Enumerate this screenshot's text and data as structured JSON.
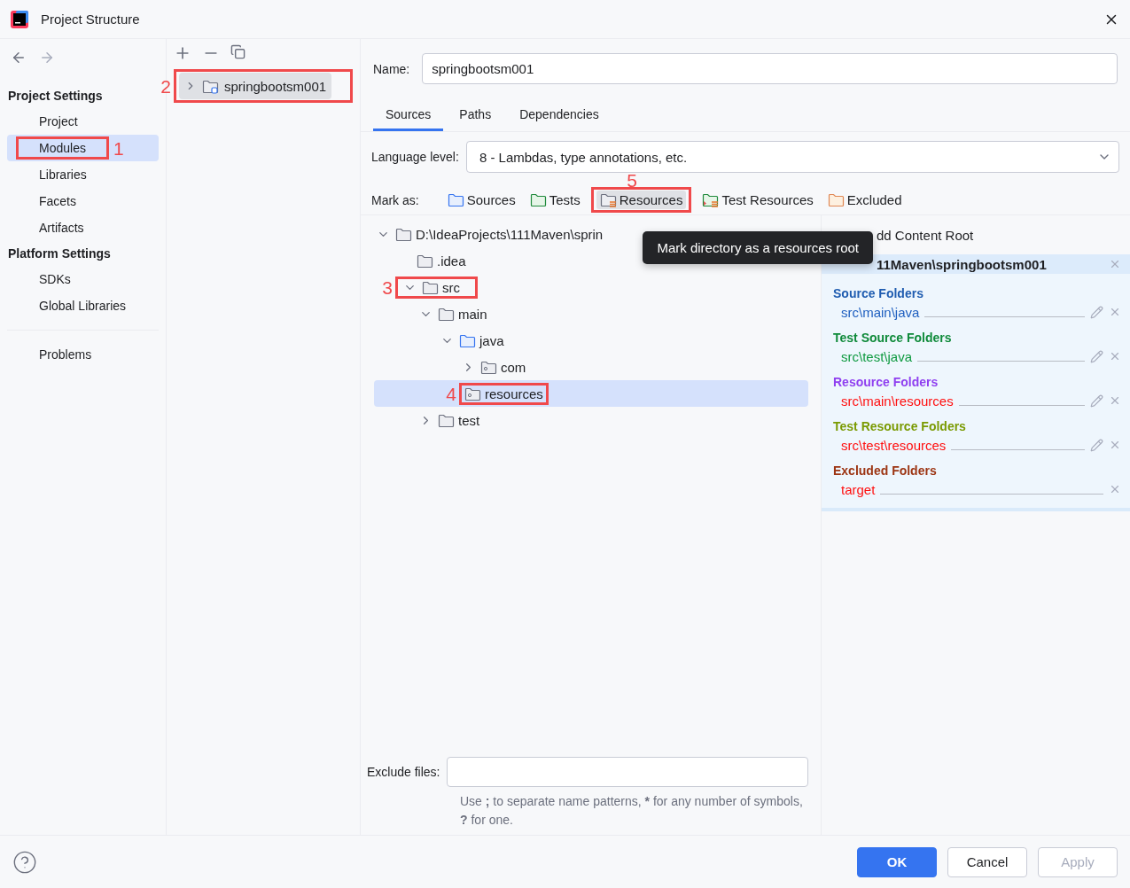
{
  "window": {
    "title": "Project Structure"
  },
  "sidebar": {
    "sections": [
      {
        "title": "Project Settings",
        "items": [
          {
            "label": "Project",
            "selected": false
          },
          {
            "label": "Modules",
            "selected": true,
            "annotation": "1"
          },
          {
            "label": "Libraries",
            "selected": false
          },
          {
            "label": "Facets",
            "selected": false
          },
          {
            "label": "Artifacts",
            "selected": false
          }
        ]
      },
      {
        "title": "Platform Settings",
        "items": [
          {
            "label": "SDKs",
            "selected": false
          },
          {
            "label": "Global Libraries",
            "selected": false
          }
        ]
      }
    ],
    "extra_items": [
      {
        "label": "Problems",
        "selected": false
      }
    ]
  },
  "modules": [
    {
      "label": "springbootsm001",
      "selected": true,
      "expanded": false,
      "annotation": "2"
    }
  ],
  "name_field": {
    "label": "Name:",
    "value": "springbootsm001"
  },
  "tabs": [
    {
      "label": "Sources",
      "selected": true
    },
    {
      "label": "Paths",
      "selected": false
    },
    {
      "label": "Dependencies",
      "selected": false
    }
  ],
  "language_level": {
    "label": "Language level:",
    "value": "8 - Lambdas, type annotations, etc."
  },
  "mark_as": {
    "label": "Mark as:",
    "buttons": [
      {
        "label": "Sources",
        "kind": "sources",
        "hovered": false
      },
      {
        "label": "Tests",
        "kind": "tests",
        "hovered": false
      },
      {
        "label": "Resources",
        "kind": "resources",
        "hovered": true,
        "annotation": "5"
      },
      {
        "label": "Test Resources",
        "kind": "test-resources",
        "hovered": false
      },
      {
        "label": "Excluded",
        "kind": "excluded",
        "hovered": false
      }
    ]
  },
  "tree": [
    {
      "label": "D:\\IdeaProjects\\111Maven\\sprin",
      "kind": "plain",
      "expanded": true,
      "selected": false,
      "children": [
        {
          "label": ".idea",
          "kind": "plain",
          "selected": false
        },
        {
          "label": "src",
          "kind": "plain",
          "expanded": true,
          "selected": false,
          "annotation": "3",
          "children": [
            {
              "label": "main",
              "kind": "plain",
              "expanded": true,
              "selected": false,
              "children": [
                {
                  "label": "java",
                  "kind": "sources",
                  "expanded": true,
                  "selected": false,
                  "children": [
                    {
                      "label": "com",
                      "kind": "package",
                      "expanded": false,
                      "selected": false
                    }
                  ]
                },
                {
                  "label": "resources",
                  "kind": "package",
                  "selected": true,
                  "annotation": "4"
                }
              ]
            },
            {
              "label": "test",
              "kind": "plain",
              "expanded": false,
              "selected": false
            }
          ]
        }
      ]
    }
  ],
  "tooltip": {
    "text": "Mark directory as a resources root"
  },
  "content_root": {
    "add_label": "dd Content Root",
    "path": "11Maven\\springbootsm001",
    "groups": [
      {
        "title": "Source Folders",
        "color": "#1f5cb0",
        "items": [
          {
            "path": "src\\main\\java",
            "color": "#2060c0",
            "editable": true
          }
        ]
      },
      {
        "title": "Test Source Folders",
        "color": "#0f8a3a",
        "items": [
          {
            "path": "src\\test\\java",
            "color": "#0f9a40",
            "editable": true
          }
        ]
      },
      {
        "title": "Resource Folders",
        "color": "#8f3ff0",
        "items": [
          {
            "path": "src\\main\\resources",
            "color": "#ff1010",
            "editable": true
          }
        ]
      },
      {
        "title": "Test Resource Folders",
        "color": "#7a9a02",
        "items": [
          {
            "path": "src\\test\\resources",
            "color": "#ff1010",
            "editable": true
          }
        ]
      },
      {
        "title": "Excluded Folders",
        "color": "#9c3412",
        "items": [
          {
            "path": "target",
            "color": "#ff1010",
            "editable": false
          }
        ]
      }
    ]
  },
  "exclude_files": {
    "label": "Exclude files:",
    "hint": [
      {
        "text": "Use ",
        "bold": false
      },
      {
        "text": ";",
        "bold": true
      },
      {
        "text": " to separate name patterns, ",
        "bold": false
      },
      {
        "text": "*",
        "bold": true
      },
      {
        "text": " for any number of symbols, ",
        "bold": false
      },
      {
        "text": "?",
        "bold": true
      },
      {
        "text": " for one.",
        "bold": false
      }
    ]
  },
  "buttons": [
    {
      "label": "OK",
      "kind": "primary",
      "disabled": false
    },
    {
      "label": "Cancel",
      "kind": "normal",
      "disabled": false
    },
    {
      "label": "Apply",
      "kind": "normal",
      "disabled": true
    }
  ]
}
